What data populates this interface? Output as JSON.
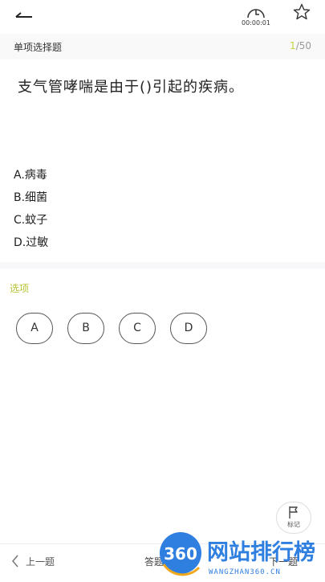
{
  "timer": {
    "label": "00:00:01"
  },
  "question_header": {
    "type": "单项选择题",
    "current": "1",
    "total": "/50"
  },
  "question": {
    "text": "支气管哮喘是由于()引起的疾病。"
  },
  "options": [
    {
      "text": "A.病毒"
    },
    {
      "text": "B.细菌"
    },
    {
      "text": "C.蚊子"
    },
    {
      "text": "D.过敏"
    }
  ],
  "choices_section": {
    "label": "选项",
    "choices": [
      "A",
      "B",
      "C",
      "D"
    ]
  },
  "mark": {
    "label": "标记"
  },
  "bottom": {
    "prev": "上一题",
    "card": "答题",
    "next": "下一题"
  },
  "watermark": {
    "badge": "360",
    "title": "网站排行榜",
    "url": "WANGZHAN360.CN"
  },
  "colors": {
    "accent": "#c7d33b",
    "option_label": "#b7c233",
    "watermark": "#2f7fe0"
  }
}
